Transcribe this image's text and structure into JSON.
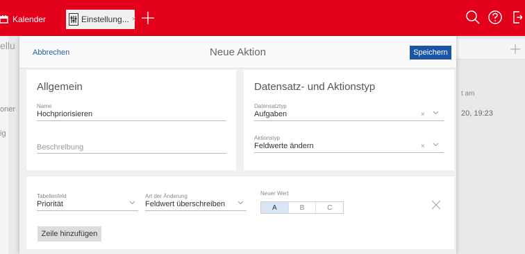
{
  "topbar": {
    "tab_calendar": "Kalender",
    "tab_settings": "Einstellung...",
    "tab_close": "×",
    "accent": "#e2001a"
  },
  "background": {
    "left_frag_1": "ellu",
    "left_frag_2": "oner",
    "left_frag_3": "ig",
    "right_frag_1": "t am",
    "right_frag_2": "20, 19:23"
  },
  "dialog": {
    "cancel_label": "Abbrechen",
    "title": "Neue Aktion",
    "save_label": "Speichern",
    "general": {
      "title": "Allgemein",
      "name_label": "Name",
      "name_value": "Hochpriorisieren",
      "description_placeholder": "Beschreibung"
    },
    "record": {
      "title": "Datensatz- und Aktionstyp",
      "record_type_label": "Datensatztyp",
      "record_type_value": "Aufgaben",
      "action_type_label": "Aktionstyp",
      "action_type_value": "Feldwerte ändern"
    },
    "rows": {
      "field_label": "Tabellenfeld",
      "field_value": "Priorität",
      "change_label": "Art der Änderung",
      "change_value": "Feldwert überschreiben",
      "new_value_label": "Neuer Wert",
      "options": [
        "A",
        "B",
        "C"
      ],
      "selected": "A",
      "add_row_label": "Zeile hinzufügen"
    }
  },
  "icons": {
    "clear": "×",
    "dropdown": "﹀"
  }
}
